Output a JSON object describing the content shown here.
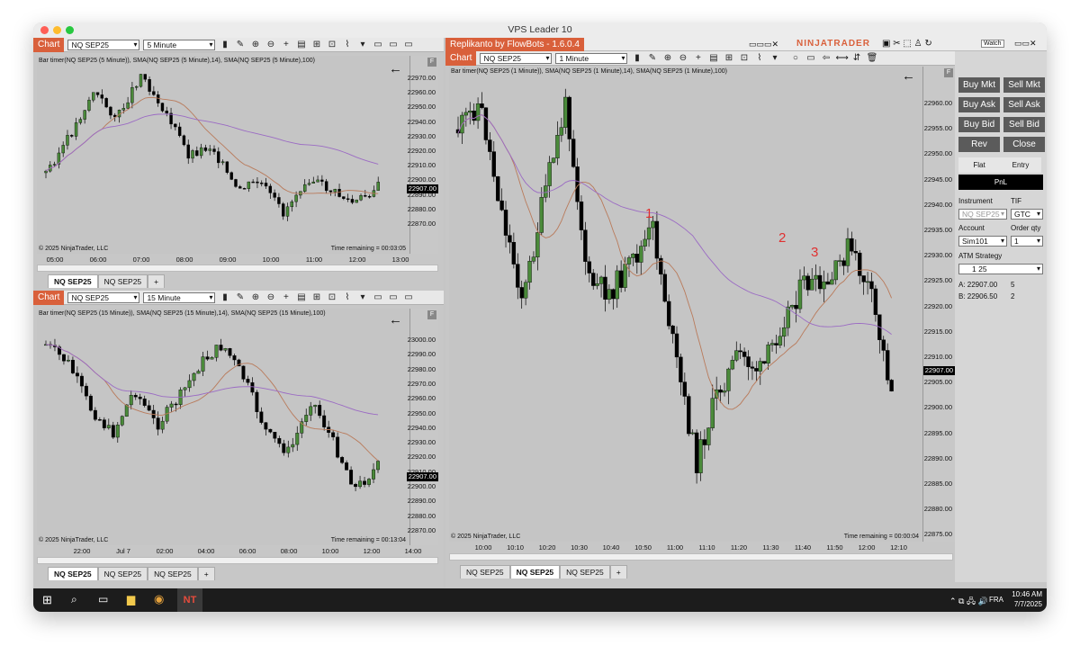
{
  "window": {
    "title": "VPS Leader 10"
  },
  "left_top": {
    "chart_label": "Chart",
    "instrument": "NQ SEP25",
    "interval": "5 Minute",
    "info": "Bar timer(NQ SEP25 (5 Minute)), SMA(NQ SEP25 (5 Minute),14), SMA(NQ SEP25 (5 Minute),100)",
    "price_tag": "22907.00",
    "y_labels": [
      "22970.00",
      "22960.00",
      "22950.00",
      "22940.00",
      "22930.00",
      "22920.00",
      "22910.00",
      "22900.00",
      "22890.00",
      "22880.00",
      "22870.00"
    ],
    "x_labels": [
      "05:00",
      "06:00",
      "07:00",
      "08:00",
      "09:00",
      "10:00",
      "11:00",
      "12:00",
      "13:00"
    ],
    "copyright": "© 2025 NinjaTrader, LLC",
    "remaining": "Time remaining = 00:03:05",
    "tabs": [
      "NQ SEP25",
      "NQ SEP25"
    ],
    "f_label": "F",
    "add_tab": "+"
  },
  "left_bottom": {
    "chart_label": "Chart",
    "instrument": "NQ SEP25",
    "interval": "15 Minute",
    "info": "Bar timer(NQ SEP25 (15 Minute)), SMA(NQ SEP25 (15 Minute),14), SMA(NQ SEP25 (15 Minute),100)",
    "price_tag": "22907.00",
    "y_labels": [
      "23000.00",
      "22990.00",
      "22980.00",
      "22970.00",
      "22960.00",
      "22950.00",
      "22940.00",
      "22930.00",
      "22920.00",
      "22910.00",
      "22900.00",
      "22890.00",
      "22880.00",
      "22870.00"
    ],
    "x_labels": [
      "22:00",
      "Jul 7",
      "02:00",
      "04:00",
      "06:00",
      "08:00",
      "10:00",
      "12:00",
      "14:00"
    ],
    "copyright": "© 2025 NinjaTrader, LLC",
    "remaining": "Time remaining = 00:13:04",
    "tabs": [
      "NQ SEP25",
      "NQ SEP25",
      "NQ SEP25"
    ],
    "f_label": "F",
    "add_tab": "+"
  },
  "right": {
    "header": "Replikanto by FlowBots - 1.6.0.4",
    "brand": "NINJATRADER",
    "watch": "Watch",
    "chart_label": "Chart",
    "instrument": "NQ SEP25",
    "interval": "1 Minute",
    "info": "Bar timer(NQ SEP25 (1 Minute)), SMA(NQ SEP25 (1 Minute),14), SMA(NQ SEP25 (1 Minute),100)",
    "price_tag": "22907.00",
    "y_labels": [
      "22960.00",
      "22955.00",
      "22950.00",
      "22945.00",
      "22940.00",
      "22935.00",
      "22930.00",
      "22925.00",
      "22920.00",
      "22915.00",
      "22910.00",
      "22905.00",
      "22900.00",
      "22895.00",
      "22890.00",
      "22885.00",
      "22880.00",
      "22875.00"
    ],
    "x_labels": [
      "10:00",
      "10:10",
      "10:20",
      "10:30",
      "10:40",
      "10:50",
      "11:00",
      "11:10",
      "11:20",
      "11:30",
      "11:40",
      "11:50",
      "12:00",
      "12:10"
    ],
    "copyright": "© 2025 NinjaTrader, LLC",
    "remaining": "Time remaining = 00:00:04",
    "annotations": [
      "1",
      "2",
      "3"
    ],
    "tabs": [
      "NQ SEP25",
      "NQ SEP25",
      "NQ SEP25"
    ],
    "f_label": "F",
    "add_tab": "+"
  },
  "order_panel": {
    "buttons": [
      "Buy Mkt",
      "Sell Mkt",
      "Buy Ask",
      "Sell Ask",
      "Buy Bid",
      "Sell Bid",
      "Rev",
      "Close"
    ],
    "flat": "Flat",
    "entry": "Entry",
    "pnl": "PnL",
    "instrument_label": "Instrument",
    "instrument_value": "NQ SEP25",
    "tif_label": "TIF",
    "tif_value": "GTC",
    "account_label": "Account",
    "account_value": "Sim101",
    "qty_label": "Order qty",
    "qty_value": "1",
    "atm_label": "ATM Strategy",
    "atm_value": "1 25",
    "ask_line": "A:  22907.00",
    "ask_size": "5",
    "bid_line": "B:  22906.50",
    "bid_size": "2"
  },
  "taskbar": {
    "lang": "FRA",
    "time": "10:46 AM",
    "date": "7/7/2025"
  }
}
